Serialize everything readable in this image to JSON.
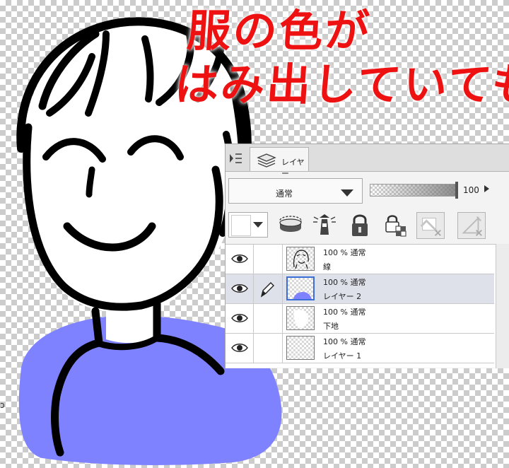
{
  "caption": {
    "line1": "服の色が",
    "line2": "はみ出していても"
  },
  "colors": {
    "caption": "#ee1111",
    "shirt": "#7f82ff",
    "selection": "#3b6fd6"
  },
  "panel": {
    "tab_label": "レイヤー",
    "blend_mode": "通常",
    "opacity": "100",
    "tools": [
      "clip-icon",
      "reference-layer-icon",
      "draft-layer-icon",
      "lock-icon",
      "lock-transparency-icon",
      "clear-layer-icon",
      "delete-layer-icon"
    ]
  },
  "layers": [
    {
      "meta": "100 % 通常",
      "name": "線",
      "selected": false,
      "editing": false,
      "visible": true,
      "thumb": "line-drawing"
    },
    {
      "meta": "100 % 通常",
      "name": "レイヤー 2",
      "selected": true,
      "editing": true,
      "visible": true,
      "thumb": "blue-shirt"
    },
    {
      "meta": "100 % 通常",
      "name": "下地",
      "selected": false,
      "editing": false,
      "visible": true,
      "thumb": "white-base"
    },
    {
      "meta": "100 % 通常",
      "name": "レイヤー 1",
      "selected": false,
      "editing": false,
      "visible": true,
      "thumb": "empty"
    }
  ],
  "edge_mark": "ɔ"
}
